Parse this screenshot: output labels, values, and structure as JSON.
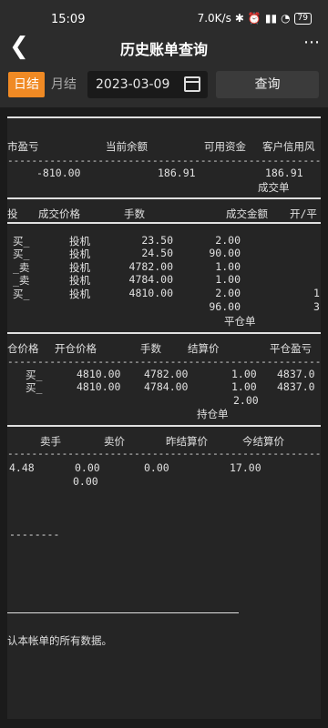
{
  "status": {
    "time": "15:09",
    "speed": "7.0K/s",
    "battery": "79"
  },
  "header": {
    "title": "历史账单查询",
    "back": "❮",
    "more": "⋯"
  },
  "filter": {
    "tab_day": "日结",
    "tab_month": "月结",
    "date": "2023-03-09",
    "query": "查询"
  },
  "summary": {
    "headers": [
      "市盈亏",
      "当前余额",
      "可用资金",
      "客户信用风"
    ],
    "dashes": "------------------------------------------------------------",
    "values": [
      "-810.00",
      "186.91",
      "186.91"
    ],
    "next_title": "成交单"
  },
  "trades": {
    "headers": [
      "投",
      "成交价格",
      "手数",
      "成交金额",
      "开/平"
    ],
    "rows": [
      {
        "c0": "买_",
        "c1": "投机",
        "c2": "23.50",
        "c3": "2.00",
        "c4": ""
      },
      {
        "c0": "买_",
        "c1": "投机",
        "c2": "24.50",
        "c3": "90.00",
        "c4": ""
      },
      {
        "c0": "_卖",
        "c1": "投机",
        "c2": "4782.00",
        "c3": "1.00",
        "c4": ""
      },
      {
        "c0": "_卖",
        "c1": "投机",
        "c2": "4784.00",
        "c3": "1.00",
        "c4": ""
      },
      {
        "c0": "买_",
        "c1": "投机",
        "c2": "4810.00",
        "c3": "2.00",
        "c4": "1"
      }
    ],
    "total": "96.00",
    "total_extra": "3",
    "next_title": "平仓单"
  },
  "close": {
    "headers": [
      "仓价格",
      "开仓价格",
      "手数",
      "结算价",
      "平仓盈亏"
    ],
    "dashes": "------------------------------------------------------------",
    "rows": [
      {
        "c0": "买_",
        "c1": "4810.00",
        "c2": "4782.00",
        "c3": "1.00",
        "c4": "4837.0"
      },
      {
        "c0": "买_",
        "c1": "4810.00",
        "c2": "4784.00",
        "c3": "1.00",
        "c4": "4837.0"
      }
    ],
    "total": "2.00",
    "next_title": "持仓单"
  },
  "hold": {
    "headers": [
      "卖手",
      "卖价",
      "昨结算价",
      "今结算价"
    ],
    "dashes": "------------------------------------------------------------",
    "row1": [
      "4.48",
      "0.00",
      "0.00",
      "17.00"
    ],
    "row2": "0.00",
    "short_dash": "--------",
    "footer": "认本帐单的所有数据。"
  }
}
